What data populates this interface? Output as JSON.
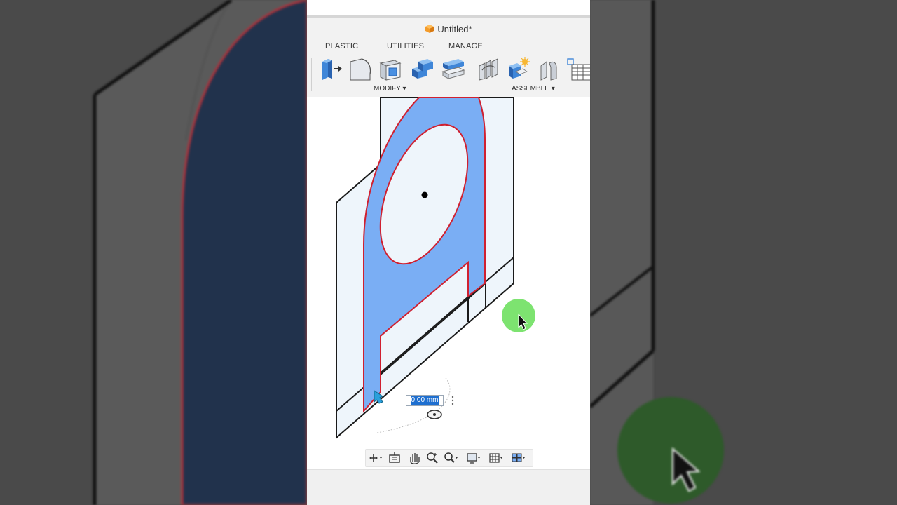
{
  "window": {
    "title": "Untitled*"
  },
  "tabs": [
    {
      "label": "PLASTIC"
    },
    {
      "label": "UTILITIES"
    },
    {
      "label": "MANAGE"
    }
  ],
  "toolbar": {
    "modify_label": "MODIFY ▾",
    "assemble_label": "ASSEMBLE ▾",
    "modify_tools": [
      "press-pull-icon",
      "fillet-icon",
      "shell-icon",
      "combine-icon",
      "offset-face-icon"
    ],
    "assemble_tools": [
      "joint-icon",
      "as-built-joint-icon",
      "joint-origin-icon",
      "table-icon"
    ]
  },
  "dimension": {
    "value": "0.00 mm"
  },
  "navigation_bar": {
    "tools": [
      "orbit-icon",
      "look-at-icon",
      "pan-icon",
      "zoom-icon",
      "zoom-window-icon",
      "display-settings-icon",
      "grid-settings-icon",
      "viewports-icon"
    ]
  },
  "colors": {
    "accent_blue": "#7aaef4",
    "sketch_red": "#d02030",
    "cursor_highlight": "#6fe060",
    "brand_orange": "#f39b2a"
  }
}
